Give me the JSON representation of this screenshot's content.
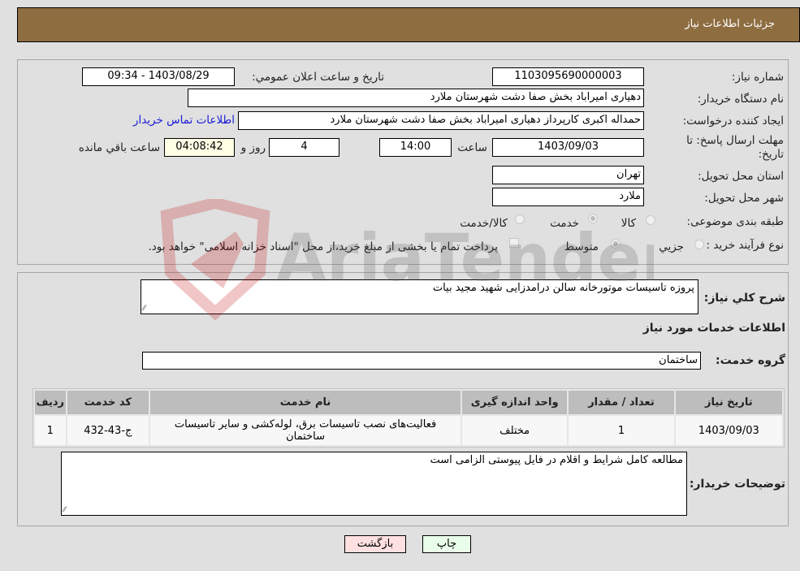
{
  "header": {
    "title": "جزئیات اطلاعات نیاز"
  },
  "details": {
    "need_number_label": "شماره نیاز:",
    "need_number": "1103095690000003",
    "announce_label": "تاریخ و ساعت اعلان عمومي:",
    "announce_value": "1403/08/29 - 09:34",
    "buyer_org_label": "نام دستگاه خریدار:",
    "buyer_org": "دهیاری امیراباد بخش صفا دشت شهرستان ملارد",
    "creator_label": "ایجاد کننده درخواست:",
    "creator": "حمداله اکبری کارپرداز دهیاری امیراباد بخش صفا دشت شهرستان ملارد",
    "contact_link": "اطلاعات تماس خریدار",
    "deadline_label_line1": "مهلت ارسال پاسخ: تا",
    "deadline_label_line2": "تاریخ:",
    "deadline_date": "1403/09/03",
    "time_label": "ساعت",
    "deadline_time": "14:00",
    "days_value": "4",
    "days_label": "روز و",
    "remaining_time": "04:08:42",
    "remaining_label": "ساعت باقي مانده",
    "province_label": "استان محل تحویل:",
    "province": "تهران",
    "city_label": "شهر محل تحویل:",
    "city": "ملارد",
    "category_label": "طبقه بندی موضوعی:",
    "category_options": [
      {
        "label": "کالا",
        "checked": false
      },
      {
        "label": "خدمت",
        "checked": true
      },
      {
        "label": "کالا/خدمت",
        "checked": false
      }
    ],
    "process_label": "نوع فرآیند خرید :",
    "process_options": [
      {
        "label": "جزيي",
        "checked": false
      },
      {
        "label": "متوسط",
        "checked": true
      }
    ],
    "treasury_checkbox_checked": false,
    "treasury_text": "پرداخت تمام یا بخشی از مبلغ خرید،از محل \"اسناد خزانه اسلامی\" خواهد بود."
  },
  "services": {
    "description_label": "شرح كلي نياز:",
    "description": "پروزه تاسیسات موتورخانه سالن درامدزایی شهید مجید بیات",
    "section_title": "اطلاعات خدمات مورد نياز",
    "group_label": "گروه خدمت:",
    "group_value": "ساختمان",
    "table": {
      "headers": [
        "رديف",
        "کد خدمت",
        "نام خدمت",
        "واحد اندازه گيری",
        "تعداد / مقدار",
        "تاریخ نیاز"
      ],
      "rows": [
        [
          "1",
          "ج-43-432",
          "فعالیت‌های نصب تاسیسات برق، لوله‌کشی و سایر تاسیسات ساختمان",
          "مختلف",
          "1",
          "1403/09/03"
        ]
      ]
    },
    "buyer_notes_label": "توضيحات خريدار:",
    "buyer_notes": "مطالعه کامل شرایط و اقلام در فایل پیوستی الزامی است"
  },
  "buttons": {
    "print": "چاپ",
    "back": "بازگشت"
  },
  "watermark": {
    "text": "AriaTender.neT"
  },
  "colors": {
    "header_bg": "#8e6d41",
    "print_bg": "#eaffea",
    "back_bg": "#ffe0e0",
    "link": "#1a1ad9"
  }
}
